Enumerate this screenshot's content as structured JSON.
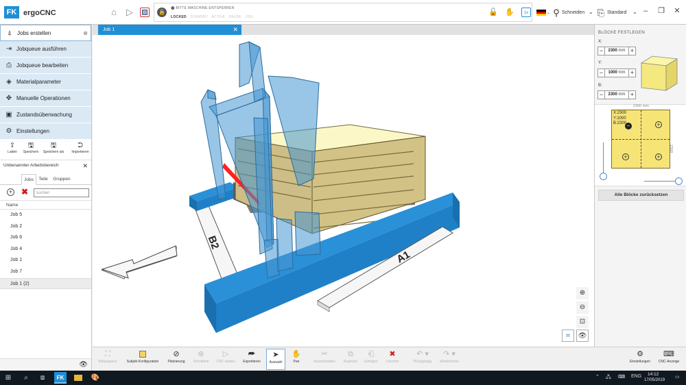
{
  "app": {
    "logo": "FK",
    "name": "ergoCNC"
  },
  "header": {
    "home_icon": "home-icon",
    "play_icon": "play-icon",
    "stop_icon": "stop-icon",
    "machine_message": "BITTE MASCHINE ENTSPERREN",
    "machine_states": [
      "LOCKED",
      "STANDBY",
      "ACTIVE",
      "PAUSE",
      "JOG"
    ],
    "active_state": "LOCKED",
    "language": "de",
    "mode": "Schneiden",
    "profile": "Standard"
  },
  "sidebar": {
    "nav": [
      {
        "label": "Jobs erstellen",
        "icon": "pen-nib-icon",
        "active": true
      },
      {
        "label": "Jobqueue ausführen",
        "icon": "queue-play-icon"
      },
      {
        "label": "Jobqueue bearbeiten",
        "icon": "queue-edit-icon"
      },
      {
        "label": "Materialparameter",
        "icon": "layers-icon"
      },
      {
        "label": "Manuelle Operationen",
        "icon": "move-icon"
      },
      {
        "label": "Zustandsüberwachung",
        "icon": "monitor-icon"
      },
      {
        "label": "Einstellungen",
        "icon": "gear-icon"
      }
    ],
    "file_actions": [
      {
        "label": "Laden",
        "icon": "load-icon"
      },
      {
        "label": "Speichern",
        "icon": "save-icon"
      },
      {
        "label": "Speichern als",
        "icon": "save-as-icon"
      },
      {
        "label": "Importieren",
        "icon": "import-icon"
      }
    ],
    "workspace_title": "Unbenannter Arbeitsbereich",
    "tabs": [
      "Jobs",
      "Teile",
      "Gruppen"
    ],
    "active_tab": "Jobs",
    "search_placeholder": "Suchen",
    "column_header": "Name",
    "jobs": [
      "Job 5",
      "Job 2",
      "Job 6",
      "Job 4",
      "Job 1",
      "Job 7",
      "Job 1 (2)"
    ],
    "selected_job": "Job 1 (2)"
  },
  "document": {
    "tab_label": "Job 1"
  },
  "scene": {
    "rail_labels": [
      "B2",
      "A1"
    ],
    "colors": {
      "rail": "#1f8fd6",
      "block_top": "#fbf7c6",
      "block_side": "#c9b97e",
      "wire": "#ff2020",
      "gantry": "rgba(70,150,210,0.55)"
    }
  },
  "toolbar": {
    "items": [
      {
        "label": "Bildsequenz",
        "icon": "film-icon",
        "enabled": false
      },
      {
        "label": "Subjob-Konfiguration",
        "icon": "subjob-icon",
        "enabled": true
      },
      {
        "label": "Platzierung",
        "icon": "placement-icon",
        "enabled": true
      },
      {
        "label": "Schnittline",
        "icon": "cut-line-icon",
        "enabled": false
      },
      {
        "label": "CNC starten",
        "icon": "play-icon",
        "enabled": false
      },
      {
        "label": "Exportieren",
        "icon": "export-icon",
        "enabled": true
      },
      {
        "label": "Auswahl",
        "icon": "cursor-icon",
        "enabled": true,
        "pressed": true
      },
      {
        "label": "Pan",
        "icon": "hand-icon",
        "enabled": true
      },
      {
        "label": "Ausschneiden",
        "icon": "scissors-icon",
        "enabled": false
      },
      {
        "label": "Kopieren",
        "icon": "copy-icon",
        "enabled": false
      },
      {
        "label": "Einfügen",
        "icon": "paste-icon",
        "enabled": false
      },
      {
        "label": "Löschen",
        "icon": "delete-icon",
        "enabled": false
      },
      {
        "label": "Rückgängig",
        "icon": "undo-icon",
        "enabled": false
      },
      {
        "label": "Wiederholen",
        "icon": "redo-icon",
        "enabled": false
      }
    ],
    "right_items": [
      {
        "label": "Einstellungen",
        "icon": "gear-icon"
      },
      {
        "label": "CNC-Anzeige",
        "icon": "cnc-display-icon"
      }
    ]
  },
  "right_panel": {
    "title": "BLÖCKE FESTLEGEN",
    "dims": [
      {
        "label": "X:",
        "value": "2300",
        "unit": "mm"
      },
      {
        "label": "Y:",
        "value": "1000",
        "unit": "mm"
      },
      {
        "label": "B:",
        "value": "2300",
        "unit": "mm"
      }
    ],
    "grid_width_label": "2300 mm",
    "grid_height_label": "2300 mm",
    "grid_info": [
      "X:2300",
      "Y:1000",
      "B:2300"
    ],
    "reset_button": "Alle Blöcke zurücksetzen"
  },
  "taskbar": {
    "time": "14:12",
    "date": "17/05/2019",
    "language": "ENG"
  }
}
